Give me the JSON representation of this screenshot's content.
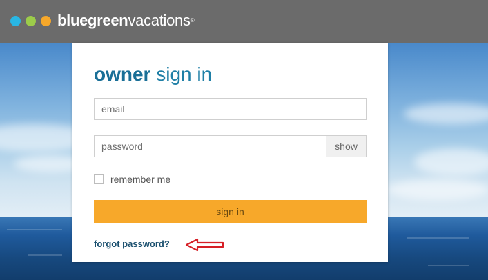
{
  "brand": {
    "name_bold": "bluegreen",
    "name_regular": "vacations",
    "mark": "®",
    "dot_colors": [
      "#29b6e3",
      "#9ccc4a",
      "#f7a82a"
    ]
  },
  "signin": {
    "title_bold": "owner",
    "title_regular": " sign in",
    "email_placeholder": "email",
    "password_placeholder": "password",
    "show_label": "show",
    "remember_label": "remember me",
    "submit_label": "sign in",
    "forgot_label": "forgot password?"
  },
  "colors": {
    "header_bg": "#6b6b6b",
    "title": "#1f7fa6",
    "submit_bg": "#f7a82a",
    "annotation_arrow": "#d61f26"
  },
  "icons": {
    "annotation": "left-arrow-icon"
  }
}
